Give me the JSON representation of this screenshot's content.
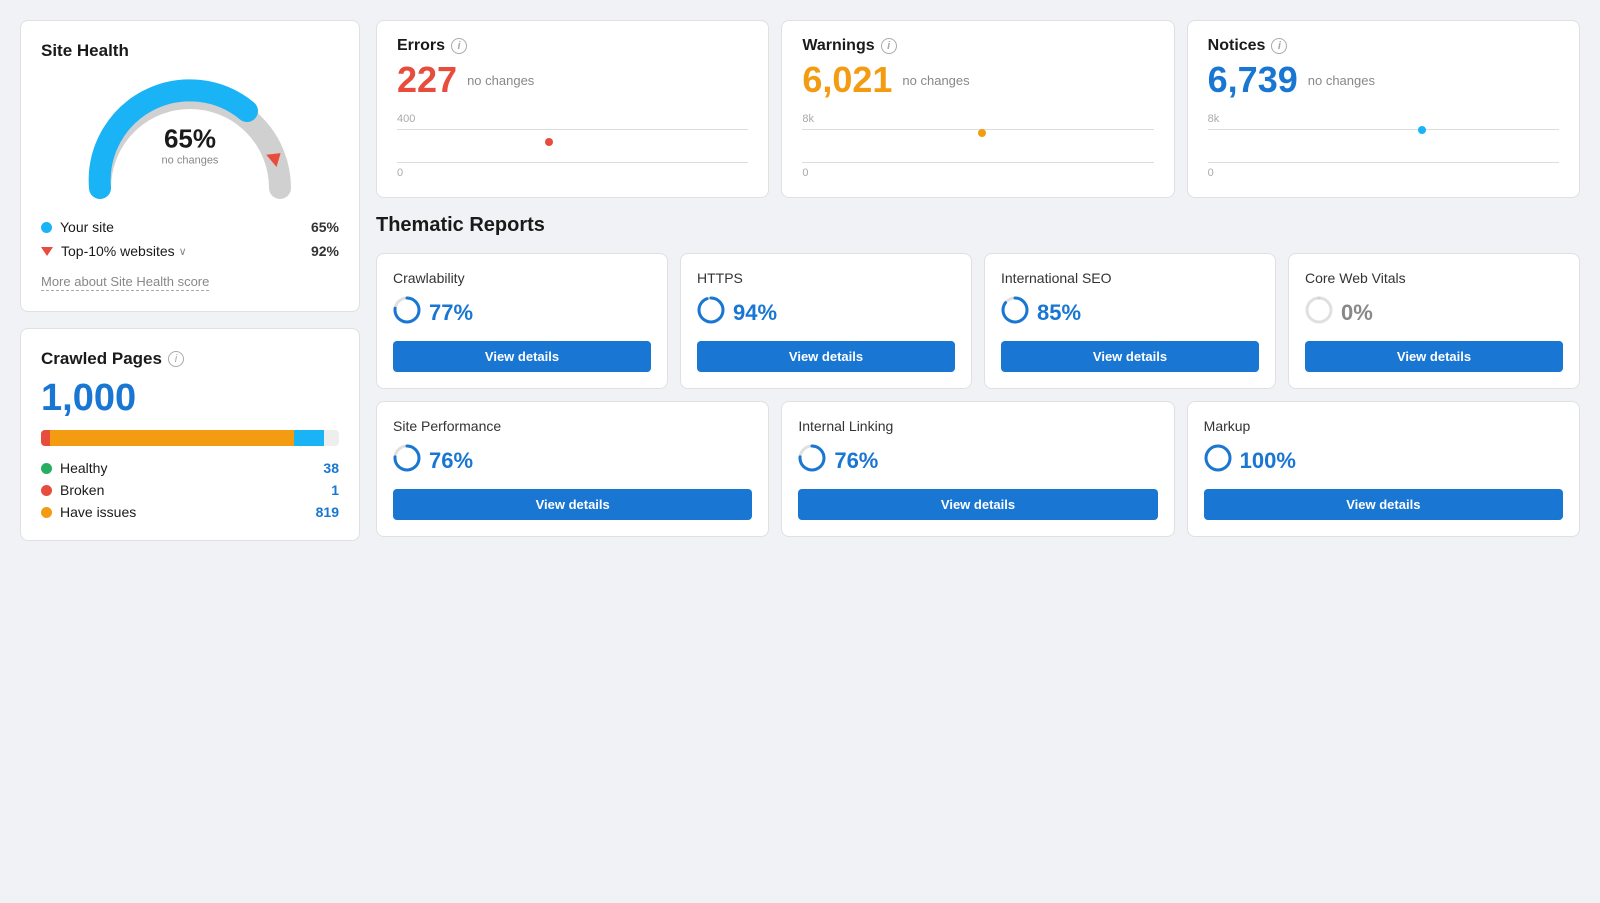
{
  "siteHealth": {
    "title": "Site Health",
    "percent": "65%",
    "sub": "no changes",
    "yourSiteLabel": "Your site",
    "yourSiteVal": "65%",
    "topSitesLabel": "Top-10% websites",
    "topSitesVal": "92%",
    "moreLink": "More about Site Health score",
    "gaugeBlue": "#1ab3f5",
    "gaugeGray": "#d0d0d0",
    "arrowColor": "#e74c3c"
  },
  "crawledPages": {
    "title": "Crawled Pages",
    "infoIcon": "i",
    "number": "1,000",
    "healthyLabel": "Healthy",
    "healthyVal": "38",
    "brokenLabel": "Broken",
    "brokenVal": "1",
    "issuesLabel": "Have issues",
    "issuesVal": "819"
  },
  "errors": {
    "title": "Errors",
    "infoIcon": "i",
    "number": "227",
    "noChanges": "no changes",
    "chartTopLabel": "400",
    "chartBottomLabel": "0"
  },
  "warnings": {
    "title": "Warnings",
    "infoIcon": "i",
    "number": "6,021",
    "noChanges": "no changes",
    "chartTopLabel": "8k",
    "chartBottomLabel": "0"
  },
  "notices": {
    "title": "Notices",
    "infoIcon": "i",
    "number": "6,739",
    "noChanges": "no changes",
    "chartTopLabel": "8k",
    "chartBottomLabel": "0"
  },
  "thematicReports": {
    "title": "Thematic Reports",
    "topRow": [
      {
        "name": "Crawlability",
        "score": "77%",
        "scoreColor": "#1976d2",
        "progress": 77,
        "btnLabel": "View details"
      },
      {
        "name": "HTTPS",
        "score": "94%",
        "scoreColor": "#1976d2",
        "progress": 94,
        "btnLabel": "View details"
      },
      {
        "name": "International SEO",
        "score": "85%",
        "scoreColor": "#1976d2",
        "progress": 85,
        "btnLabel": "View details"
      },
      {
        "name": "Core Web Vitals",
        "score": "0%",
        "scoreColor": "#888888",
        "progress": 0,
        "btnLabel": "View details"
      }
    ],
    "bottomRow": [
      {
        "name": "Site Performance",
        "score": "76%",
        "scoreColor": "#1976d2",
        "progress": 76,
        "btnLabel": "View details"
      },
      {
        "name": "Internal Linking",
        "score": "76%",
        "scoreColor": "#1976d2",
        "progress": 76,
        "btnLabel": "View details"
      },
      {
        "name": "Markup",
        "score": "100%",
        "scoreColor": "#1976d2",
        "progress": 100,
        "btnLabel": "View details"
      }
    ]
  }
}
